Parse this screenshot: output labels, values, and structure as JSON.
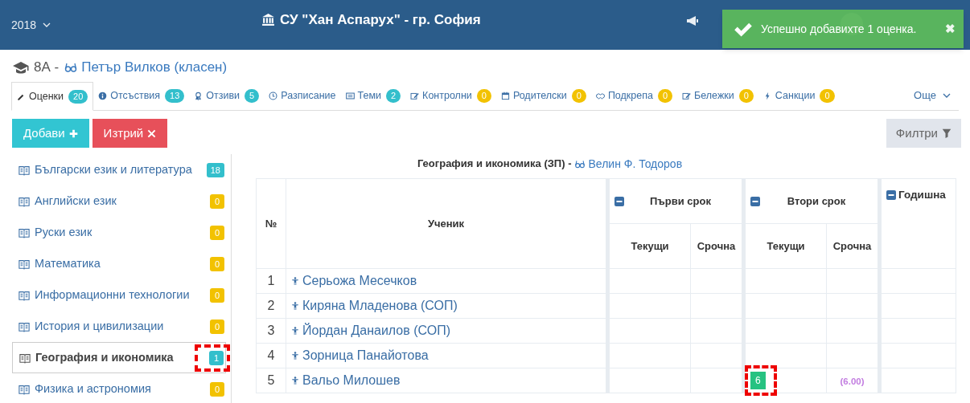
{
  "header": {
    "year": "2018",
    "school": "СУ \"Хан Аспарух\" - гр. София"
  },
  "toast": {
    "message": "Успешно добавихте 1 оценка.",
    "close": "✖"
  },
  "page_title": {
    "class_name": "8А -",
    "teacher": "Петър Вилков (класен)"
  },
  "tabs": [
    {
      "label": "Оценки",
      "count": "20",
      "color": "#33bfcc",
      "selected": true
    },
    {
      "label": "Отсъствия",
      "count": "13",
      "color": "#33bfcc",
      "selected": false
    },
    {
      "label": "Отзиви",
      "count": "5",
      "color": "#33bfcc",
      "selected": false
    },
    {
      "label": "Разписание",
      "selected": false
    },
    {
      "label": "Теми",
      "count": "2",
      "color": "#33bfcc",
      "selected": false
    },
    {
      "label": "Контролни",
      "count": "0",
      "color": "#f2c200",
      "selected": false
    },
    {
      "label": "Родителски",
      "count": "0",
      "color": "#f2c200",
      "selected": false
    },
    {
      "label": "Подкрепа",
      "count": "0",
      "color": "#f2c200",
      "selected": false
    },
    {
      "label": "Бележки",
      "count": "0",
      "color": "#f2c200",
      "selected": false
    },
    {
      "label": "Санкции",
      "count": "0",
      "color": "#f2c200",
      "selected": false
    }
  ],
  "more_menu": "Още",
  "buttons": [
    {
      "label": "Добави",
      "kind": "add"
    },
    {
      "label": "Изтрий",
      "kind": "delete"
    }
  ],
  "filter_button": "Филтри",
  "subjects": [
    {
      "name": "Български език и литература",
      "count": "18",
      "color": "#33bfcc",
      "selected": false,
      "highlighted": false
    },
    {
      "name": "Английски език",
      "count": "0",
      "color": "#f2c200",
      "selected": false,
      "highlighted": false
    },
    {
      "name": "Руски език",
      "count": "0",
      "color": "#f2c200",
      "selected": false,
      "highlighted": false
    },
    {
      "name": "Математика",
      "count": "0",
      "color": "#f2c200",
      "selected": false,
      "highlighted": false
    },
    {
      "name": "Информационни технологии",
      "count": "0",
      "color": "#f2c200",
      "selected": false,
      "highlighted": false
    },
    {
      "name": "История и цивилизации",
      "count": "0",
      "color": "#f2c200",
      "selected": false,
      "highlighted": false
    },
    {
      "name": "География и икономика",
      "count": "1",
      "color": "#33bfcc",
      "selected": true,
      "highlighted": true
    },
    {
      "name": "Физика и астрономия",
      "count": "0",
      "color": "#f2c200",
      "selected": false,
      "highlighted": false
    }
  ],
  "table": {
    "title": "География и икономика (ЗП) -",
    "teacher": "Велин Ф. Тодоров",
    "columns": {
      "number": "№",
      "student": "Ученик",
      "annual": "Годишна"
    },
    "terms": [
      {
        "label": "Първи срок",
        "current": "Текущи",
        "final": "Срочна"
      },
      {
        "label": "Втори срок",
        "current": "Текущи",
        "final": "Срочна"
      }
    ],
    "rows": [
      {
        "number": "1",
        "name": "Серьожа Месечков"
      },
      {
        "number": "2",
        "name": "Киряна Младенова (СОП)"
      },
      {
        "number": "3",
        "name": "Йордан Данаилов (СОП)"
      },
      {
        "number": "4",
        "name": "Зорница Панайотова"
      },
      {
        "number": "5",
        "name": "Вальо Милошев",
        "second_term_grades": [
          {
            "value": "6",
            "highlighted": true
          }
        ],
        "second_term_final": "(6.00)"
      }
    ]
  }
}
